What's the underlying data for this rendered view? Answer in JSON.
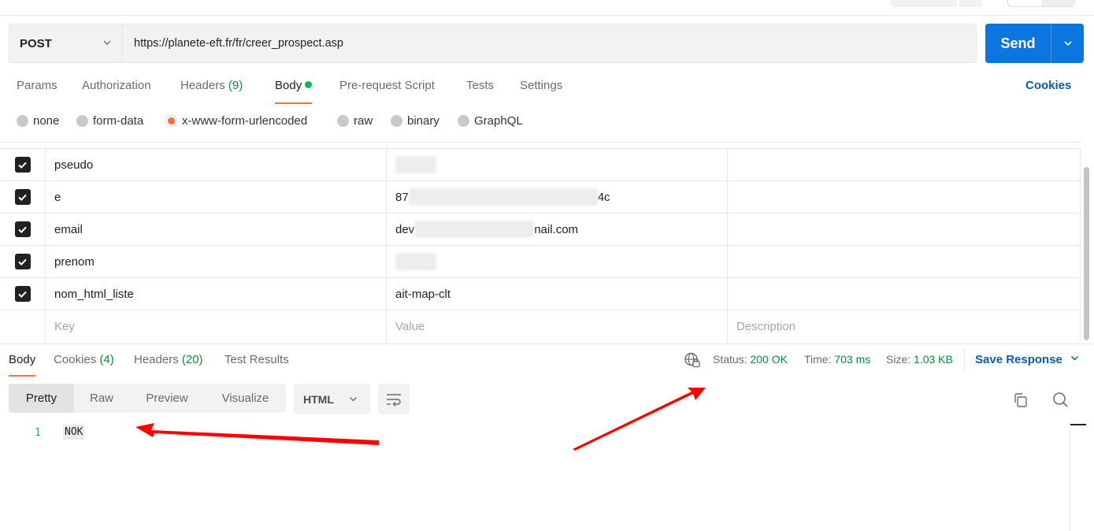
{
  "request": {
    "method": "POST",
    "url": "https://planete-eft.fr/fr/creer_prospect.asp",
    "send_label": "Send"
  },
  "request_tabs": [
    {
      "label": "Params"
    },
    {
      "label": "Authorization"
    },
    {
      "label": "Headers",
      "count": "(9)"
    },
    {
      "label": "Body"
    },
    {
      "label": "Pre-request Script"
    },
    {
      "label": "Tests"
    },
    {
      "label": "Settings"
    }
  ],
  "cookies_link": "Cookies",
  "body_types": [
    {
      "label": "none",
      "selected": false
    },
    {
      "label": "form-data",
      "selected": false
    },
    {
      "label": "x-www-form-urlencoded",
      "selected": true
    },
    {
      "label": "raw",
      "selected": false
    },
    {
      "label": "binary",
      "selected": false
    },
    {
      "label": "GraphQL",
      "selected": false
    }
  ],
  "params": [
    {
      "key": "pseudo",
      "value_prefix": "",
      "value_suffix": "",
      "checked": true,
      "redacted": true
    },
    {
      "key": "e",
      "value_prefix": "87",
      "value_suffix": "4c",
      "checked": true,
      "redacted": true
    },
    {
      "key": "email",
      "value_prefix": "dev",
      "value_suffix": "nail.com",
      "checked": true,
      "redacted": true
    },
    {
      "key": "prenom",
      "value_prefix": "",
      "value_suffix": "",
      "checked": true,
      "redacted": true
    },
    {
      "key": "nom_html_liste",
      "value_prefix": "ait-map-clt",
      "value_suffix": "",
      "checked": true,
      "redacted": false
    }
  ],
  "placeholders": {
    "key": "Key",
    "value": "Value",
    "description": "Description"
  },
  "response_tabs": [
    {
      "label": "Body"
    },
    {
      "label": "Cookies",
      "count": "(4)"
    },
    {
      "label": "Headers",
      "count": "(20)"
    },
    {
      "label": "Test Results"
    }
  ],
  "response_meta": {
    "status_label": "Status:",
    "status_value": "200 OK",
    "time_label": "Time:",
    "time_value": "703 ms",
    "size_label": "Size:",
    "size_value": "1.03 KB",
    "save_response": "Save Response"
  },
  "view_modes": [
    "Pretty",
    "Raw",
    "Preview",
    "Visualize"
  ],
  "language": "HTML",
  "response_body": {
    "line_number": "1",
    "text": "NOK"
  },
  "colors": {
    "accent_orange": "#ff6c37",
    "send_blue": "#0b76e0",
    "link_blue": "#0b5cad",
    "success_green": "#0c8a3d",
    "annotation_red": "#ff0000"
  },
  "icons": [
    "chevron-down-icon",
    "checkbox-checked-icon",
    "globe-lock-icon",
    "wrap-lines-icon",
    "copy-icon",
    "search-icon",
    "red-arrow-annotation"
  ]
}
